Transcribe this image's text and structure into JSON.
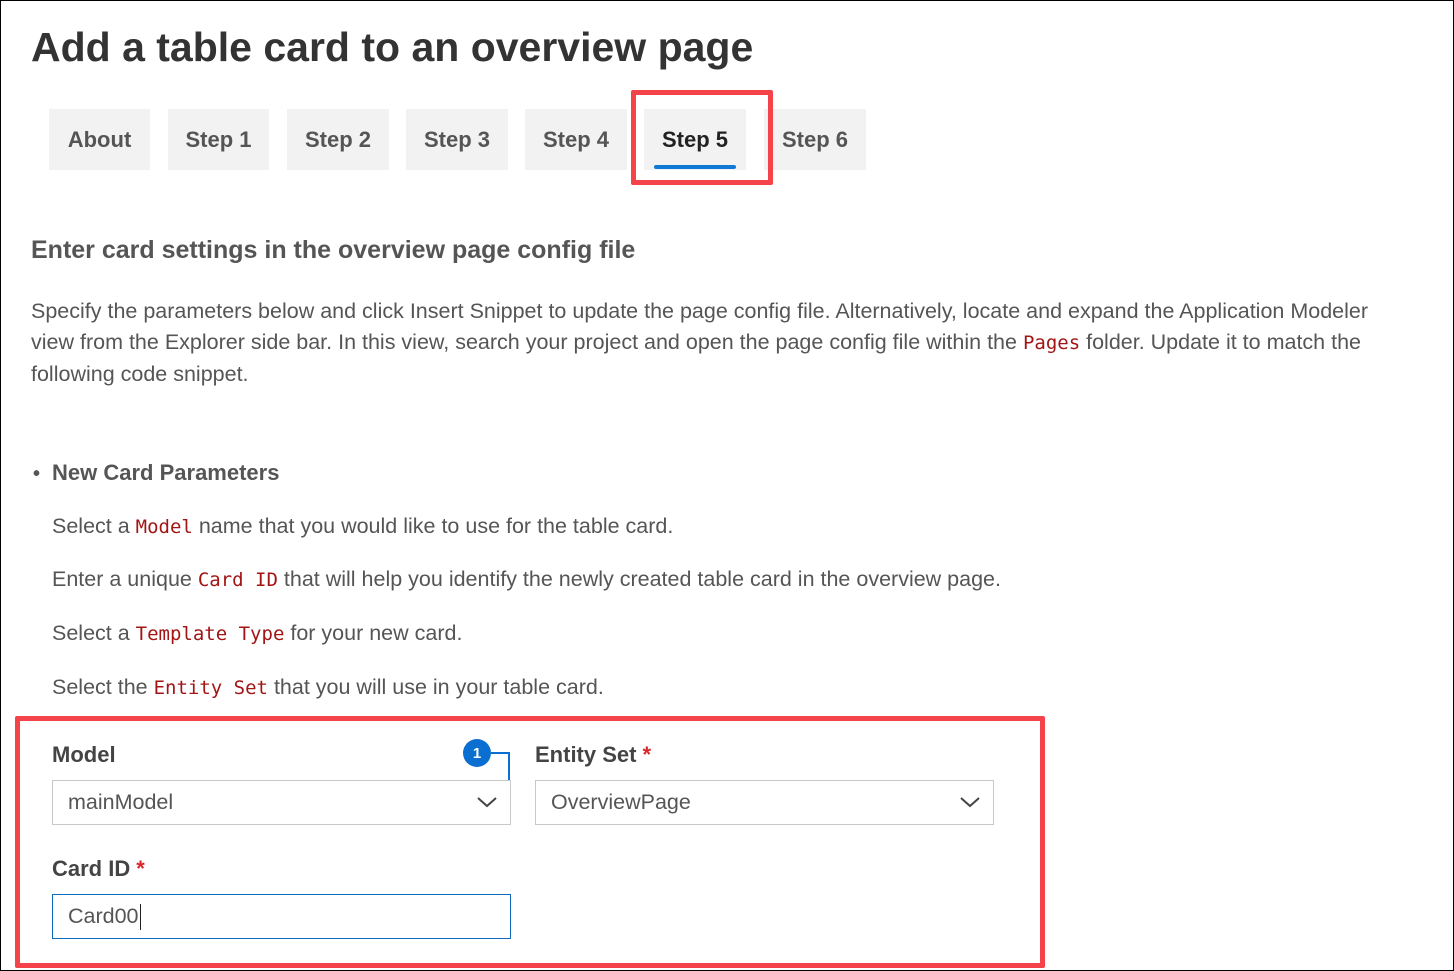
{
  "page": {
    "title": "Add a table card to an overview page"
  },
  "tabs": [
    {
      "label": "About",
      "active": false
    },
    {
      "label": "Step 1",
      "active": false
    },
    {
      "label": "Step 2",
      "active": false
    },
    {
      "label": "Step 3",
      "active": false
    },
    {
      "label": "Step 4",
      "active": false
    },
    {
      "label": "Step 5",
      "active": true
    },
    {
      "label": "Step 6",
      "active": false
    }
  ],
  "section": {
    "heading": "Enter card settings in the overview page config file",
    "desc_part1": "Specify the parameters below and click Insert Snippet to update the page config file. Alternatively, locate and expand the Application Modeler view from the Explorer side bar. In this view, search your project and open the page config file within the ",
    "desc_code": "Pages",
    "desc_part2": " folder. Update it to match the following code snippet."
  },
  "parameters": {
    "bullet_title": "New Card Parameters",
    "model_instr_pre": "Select a ",
    "model_instr_code": "Model",
    "model_instr_post": " name that you would like to use for the table card.",
    "cardid_instr_pre": "Enter a unique ",
    "cardid_instr_code": "Card ID",
    "cardid_instr_post": " that will help you identify the newly created table card in the overview page.",
    "template_instr_pre": "Select a ",
    "template_instr_code": "Template Type",
    "template_instr_post": " for your new card.",
    "entity_instr_pre": "Select the ",
    "entity_instr_code": "Entity Set",
    "entity_instr_post": " that you will use in your table card."
  },
  "form": {
    "model_label": "Model",
    "model_value": "mainModel",
    "entity_label": "Entity Set",
    "entity_value": "OverviewPage",
    "cardid_label": "Card ID",
    "cardid_value": "Card00",
    "required_mark": "*",
    "badge_number": "1"
  },
  "colors": {
    "highlight": "#f44349",
    "accent": "#0f7ad6",
    "code": "#a31515"
  }
}
